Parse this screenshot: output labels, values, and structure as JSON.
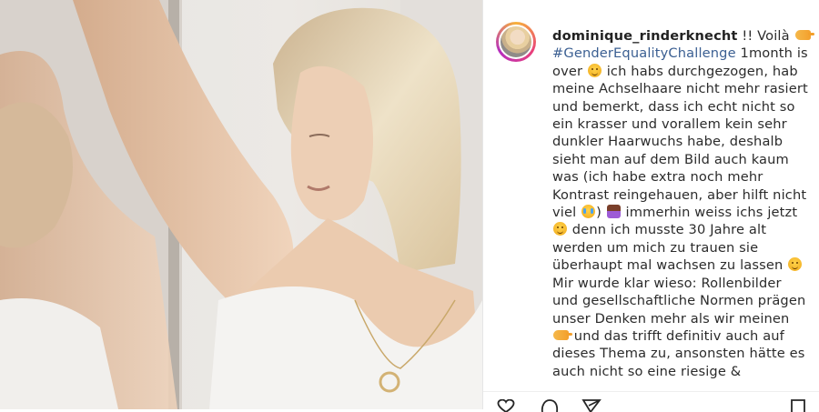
{
  "photo": {
    "alt": "",
    "palette": {
      "wall": "#e9e7e4",
      "hair": "#e6d6b6",
      "skin": "#e9c9ad",
      "shirt": "#f2f1ef",
      "necklace": "#c9a86a"
    }
  },
  "post": {
    "username": "dominique_rinderknecht",
    "caption_lines": [
      {
        "parts": [
          {
            "t": "user",
            "v": "dominique_rinderknecht"
          },
          {
            "t": "text",
            "v": " !! Voilà "
          },
          {
            "t": "emoji",
            "v": "hand"
          }
        ]
      },
      {
        "parts": [
          {
            "t": "tag",
            "v": "#GenderEqualityChallenge"
          },
          {
            "t": "text",
            "v": " 1month is"
          }
        ]
      },
      {
        "parts": [
          {
            "t": "text",
            "v": "over "
          },
          {
            "t": "emoji",
            "v": "face"
          },
          {
            "t": "text",
            "v": " ich habs durchgezogen, hab"
          }
        ]
      },
      {
        "parts": [
          {
            "t": "text",
            "v": "meine Achselhaare nicht mehr rasiert"
          }
        ]
      },
      {
        "parts": [
          {
            "t": "text",
            "v": "und bemerkt, dass ich echt nicht so"
          }
        ]
      },
      {
        "parts": [
          {
            "t": "text",
            "v": "ein krasser und vorallem kein sehr"
          }
        ]
      },
      {
        "parts": [
          {
            "t": "text",
            "v": "dunkler Haarwuchs habe, deshalb"
          }
        ]
      },
      {
        "parts": [
          {
            "t": "text",
            "v": "sieht man auf dem Bild auch kaum"
          }
        ]
      },
      {
        "parts": [
          {
            "t": "text",
            "v": "was (ich habe extra noch mehr"
          }
        ]
      },
      {
        "parts": [
          {
            "t": "text",
            "v": "Kontrast reingehauen, aber hilft nicht"
          }
        ]
      },
      {
        "parts": [
          {
            "t": "text",
            "v": "viel "
          },
          {
            "t": "emoji",
            "v": "cry"
          },
          {
            "t": "text",
            "v": ") "
          },
          {
            "t": "emoji",
            "v": "person"
          },
          {
            "t": "text",
            "v": " immerhin weiss ichs jetzt"
          }
        ]
      },
      {
        "parts": [
          {
            "t": "emoji",
            "v": "face"
          },
          {
            "t": "text",
            "v": " denn ich musste 30 Jahre alt"
          }
        ]
      },
      {
        "parts": [
          {
            "t": "text",
            "v": "werden um mich zu trauen sie"
          }
        ]
      },
      {
        "parts": [
          {
            "t": "text",
            "v": "überhaupt mal wachsen zu lassen "
          },
          {
            "t": "emoji",
            "v": "face"
          }
        ]
      },
      {
        "parts": [
          {
            "t": "text",
            "v": "Mir wurde klar wieso: Rollenbilder"
          }
        ]
      },
      {
        "parts": [
          {
            "t": "text",
            "v": "und gesellschaftliche Normen prägen"
          }
        ]
      },
      {
        "parts": [
          {
            "t": "text",
            "v": "unser Denken mehr als wir meinen"
          }
        ]
      },
      {
        "parts": [
          {
            "t": "emoji",
            "v": "hand"
          },
          {
            "t": "text",
            "v": " und das trifft definitiv auch auf"
          }
        ]
      },
      {
        "parts": [
          {
            "t": "text",
            "v": "dieses Thema zu, ansonsten hätte es"
          }
        ]
      },
      {
        "parts": [
          {
            "t": "text",
            "v": "auch nicht so eine riesige &"
          }
        ]
      }
    ]
  },
  "actions": {
    "icons": [
      "heart-icon",
      "comment-icon",
      "share-icon",
      "bookmark-icon"
    ]
  },
  "colors": {
    "text": "#2b2b2b",
    "hashtag": "#3b5f92",
    "avatar_ring_start": "#f7b23b",
    "avatar_ring_end": "#b52dbf"
  }
}
